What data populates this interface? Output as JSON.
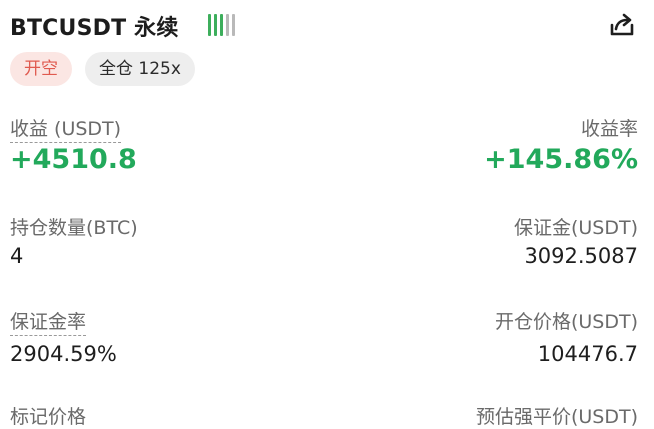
{
  "header": {
    "symbol": "BTCUSDT 永续",
    "signal_bars": [
      "#3dae5c",
      "#3dae5c",
      "#3dae5c",
      "#b9b9b9",
      "#b9b9b9"
    ],
    "share_icon": "share-icon"
  },
  "tags": {
    "side": "开空",
    "mode": "全仓 125x"
  },
  "stats": {
    "pnl_label": "收益 (USDT)",
    "pnl_value": "+4510.8",
    "roi_label": "收益率",
    "roi_value": "+145.86%",
    "size_label": "持仓数量(BTC)",
    "size_value": "4",
    "margin_label": "保证金(USDT)",
    "margin_value": "3092.5087",
    "margin_ratio_label": "保证金率",
    "margin_ratio_value": "2904.59%",
    "entry_label": "开仓价格(USDT)",
    "entry_value": "104476.7",
    "mark_label": "标记价格",
    "liq_label": "预估强平价(USDT)"
  },
  "colors": {
    "profit": "#22a95b",
    "short": "#e05a4f",
    "short_bg": "#fbe6e3"
  }
}
